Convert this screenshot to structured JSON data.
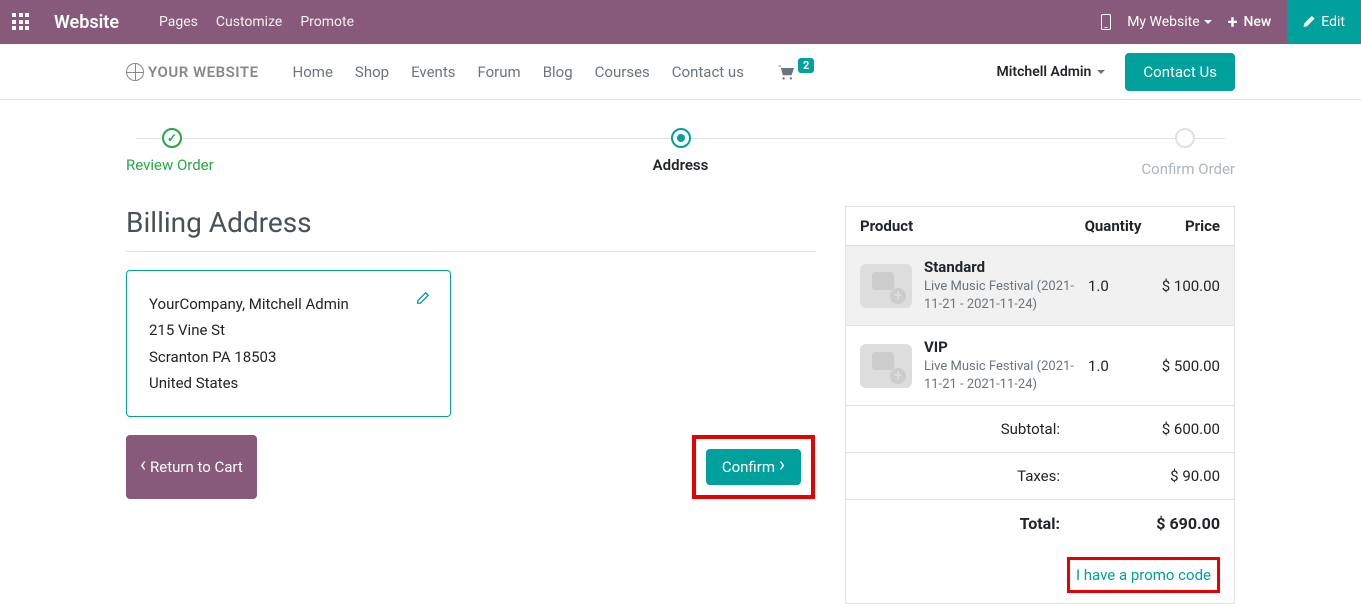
{
  "topbar": {
    "brand": "Website",
    "links": [
      "Pages",
      "Customize",
      "Promote"
    ],
    "my_website": "My Website",
    "new_label": "New",
    "edit_label": "Edit"
  },
  "site_header": {
    "logo_text": "YOUR WEBSITE",
    "nav": [
      "Home",
      "Shop",
      "Events",
      "Forum",
      "Blog",
      "Courses",
      "Contact us"
    ],
    "cart_count": "2",
    "user": "Mitchell Admin",
    "contact_btn": "Contact Us"
  },
  "wizard": {
    "step1": "Review Order",
    "step2": "Address",
    "step3": "Confirm Order"
  },
  "billing": {
    "title": "Billing Address",
    "line1": "YourCompany, Mitchell Admin",
    "line2": "215 Vine St",
    "line3": "Scranton PA 18503",
    "line4": "United States"
  },
  "actions": {
    "return": "Return to Cart",
    "confirm": "Confirm"
  },
  "summary": {
    "headers": {
      "product": "Product",
      "quantity": "Quantity",
      "price": "Price"
    },
    "items": [
      {
        "name": "Standard",
        "desc": "Live Music Festival (2021-11-21 - 2021-11-24)",
        "qty": "1.0",
        "price": "$ 100.00"
      },
      {
        "name": "VIP",
        "desc": "Live Music Festival (2021-11-21 - 2021-11-24)",
        "qty": "1.0",
        "price": "$ 500.00"
      }
    ],
    "subtotal_label": "Subtotal:",
    "subtotal_val": "$ 600.00",
    "taxes_label": "Taxes:",
    "taxes_val": "$ 90.00",
    "total_label": "Total:",
    "total_val": "$ 690.00",
    "promo": "I have a promo code"
  }
}
